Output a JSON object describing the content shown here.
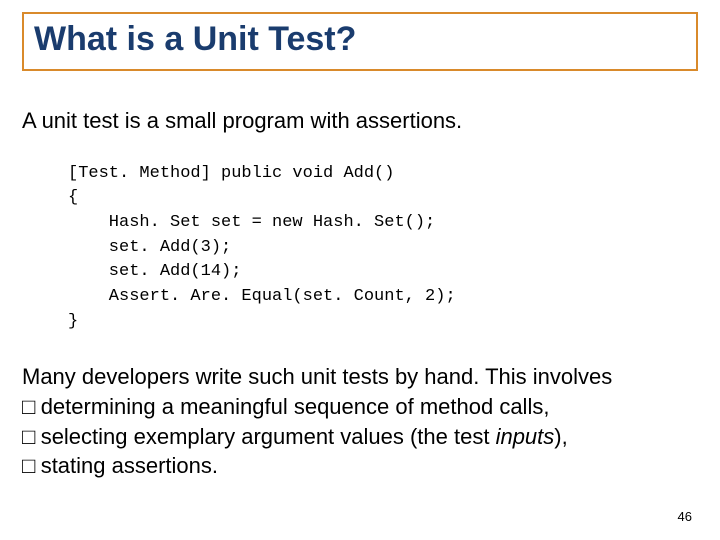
{
  "title": "What is a Unit Test?",
  "intro": "A unit test is a small program with assertions.",
  "code": {
    "l1": "[Test. Method] public void Add()",
    "l2": "{",
    "l3": "    Hash. Set set = new Hash. Set();",
    "l4": "    set. Add(3);",
    "l5": "    set. Add(14);",
    "l6": "    Assert. Are. Equal(set. Count, 2);",
    "l7": "}"
  },
  "outro": {
    "lead": "Many developers write such unit tests by hand. This involves",
    "b1": "determining a meaningful sequence of method calls,",
    "b2_pre": "selecting exemplary argument values (the test ",
    "b2_em": "inputs",
    "b2_post": "),",
    "b3": "stating assertions."
  },
  "glyph": "□",
  "page": "46"
}
